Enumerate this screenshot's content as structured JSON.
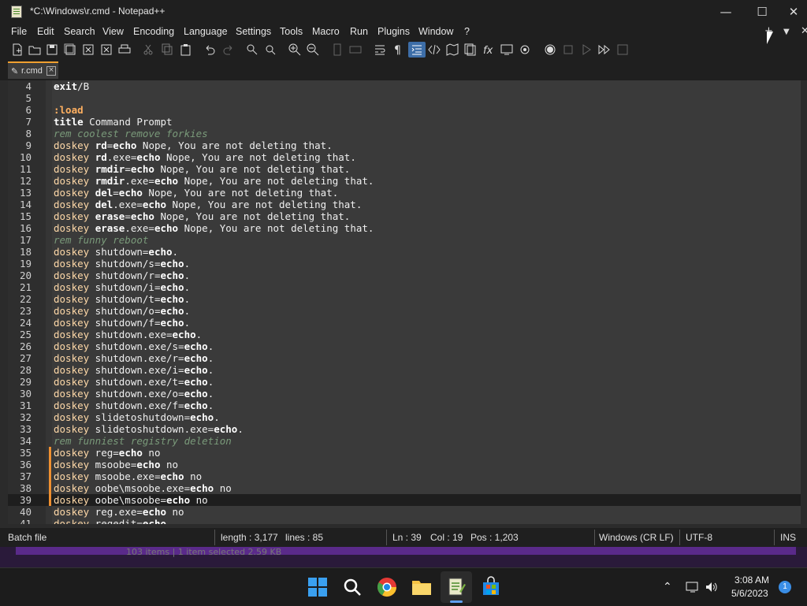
{
  "window": {
    "title": "*C:\\Windows\\r.cmd - Notepad++"
  },
  "menu": [
    "File",
    "Edit",
    "Search",
    "View",
    "Encoding",
    "Language",
    "Settings",
    "Tools",
    "Macro",
    "Run",
    "Plugins",
    "Window",
    "?"
  ],
  "menu_right": {
    "plus": "+",
    "dropdown": "▼",
    "close": "✕"
  },
  "tab": {
    "name": "r.cmd"
  },
  "lines": [
    {
      "n": "4",
      "parts": [
        [
          "cmd",
          "exit"
        ],
        [
          "",
          "/B"
        ]
      ]
    },
    {
      "n": "5",
      "parts": []
    },
    {
      "n": "6",
      "parts": [
        [
          "lbl",
          ":load"
        ]
      ]
    },
    {
      "n": "7",
      "parts": [
        [
          "cmd",
          "title"
        ],
        [
          "",
          " Command Prompt"
        ]
      ]
    },
    {
      "n": "8",
      "parts": [
        [
          "cmt",
          "rem coolest remove forkies"
        ]
      ]
    },
    {
      "n": "9",
      "parts": [
        [
          "kw",
          "doskey"
        ],
        [
          "",
          " "
        ],
        [
          "cmd",
          "rd"
        ],
        [
          "",
          "="
        ],
        [
          "cmd",
          "echo"
        ],
        [
          "",
          " Nope, You are not deleting that."
        ]
      ]
    },
    {
      "n": "10",
      "parts": [
        [
          "kw",
          "doskey"
        ],
        [
          "",
          " "
        ],
        [
          "cmd",
          "rd"
        ],
        [
          "",
          ".exe="
        ],
        [
          "cmd",
          "echo"
        ],
        [
          "",
          " Nope, You are not deleting that."
        ]
      ]
    },
    {
      "n": "11",
      "parts": [
        [
          "kw",
          "doskey"
        ],
        [
          "",
          " "
        ],
        [
          "cmd",
          "rmdir"
        ],
        [
          "",
          "="
        ],
        [
          "cmd",
          "echo"
        ],
        [
          "",
          " Nope, You are not deleting that."
        ]
      ]
    },
    {
      "n": "12",
      "parts": [
        [
          "kw",
          "doskey"
        ],
        [
          "",
          " "
        ],
        [
          "cmd",
          "rmdir"
        ],
        [
          "",
          ".exe="
        ],
        [
          "cmd",
          "echo"
        ],
        [
          "",
          " Nope, You are not deleting that."
        ]
      ]
    },
    {
      "n": "13",
      "parts": [
        [
          "kw",
          "doskey"
        ],
        [
          "",
          " "
        ],
        [
          "cmd",
          "del"
        ],
        [
          "",
          "="
        ],
        [
          "cmd",
          "echo"
        ],
        [
          "",
          " Nope, You are not deleting that."
        ]
      ]
    },
    {
      "n": "14",
      "parts": [
        [
          "kw",
          "doskey"
        ],
        [
          "",
          " "
        ],
        [
          "cmd",
          "del"
        ],
        [
          "",
          ".exe="
        ],
        [
          "cmd",
          "echo"
        ],
        [
          "",
          " Nope, You are not deleting that."
        ]
      ]
    },
    {
      "n": "15",
      "parts": [
        [
          "kw",
          "doskey"
        ],
        [
          "",
          " "
        ],
        [
          "cmd",
          "erase"
        ],
        [
          "",
          "="
        ],
        [
          "cmd",
          "echo"
        ],
        [
          "",
          " Nope, You are not deleting that."
        ]
      ]
    },
    {
      "n": "16",
      "parts": [
        [
          "kw",
          "doskey"
        ],
        [
          "",
          " "
        ],
        [
          "cmd",
          "erase"
        ],
        [
          "",
          ".exe="
        ],
        [
          "cmd",
          "echo"
        ],
        [
          "",
          " Nope, You are not deleting that."
        ]
      ]
    },
    {
      "n": "17",
      "parts": [
        [
          "cmt",
          "rem funny reboot"
        ]
      ]
    },
    {
      "n": "18",
      "parts": [
        [
          "kw",
          "doskey"
        ],
        [
          "",
          " shutdown="
        ],
        [
          "cmd",
          "echo"
        ],
        [
          "",
          "."
        ]
      ]
    },
    {
      "n": "19",
      "parts": [
        [
          "kw",
          "doskey"
        ],
        [
          "",
          " shutdown/s="
        ],
        [
          "cmd",
          "echo"
        ],
        [
          "",
          "."
        ]
      ]
    },
    {
      "n": "20",
      "parts": [
        [
          "kw",
          "doskey"
        ],
        [
          "",
          " shutdown/r="
        ],
        [
          "cmd",
          "echo"
        ],
        [
          "",
          "."
        ]
      ]
    },
    {
      "n": "21",
      "parts": [
        [
          "kw",
          "doskey"
        ],
        [
          "",
          " shutdown/i="
        ],
        [
          "cmd",
          "echo"
        ],
        [
          "",
          "."
        ]
      ]
    },
    {
      "n": "22",
      "parts": [
        [
          "kw",
          "doskey"
        ],
        [
          "",
          " shutdown/t="
        ],
        [
          "cmd",
          "echo"
        ],
        [
          "",
          "."
        ]
      ]
    },
    {
      "n": "23",
      "parts": [
        [
          "kw",
          "doskey"
        ],
        [
          "",
          " shutdown/o="
        ],
        [
          "cmd",
          "echo"
        ],
        [
          "",
          "."
        ]
      ]
    },
    {
      "n": "24",
      "parts": [
        [
          "kw",
          "doskey"
        ],
        [
          "",
          " shutdown/f="
        ],
        [
          "cmd",
          "echo"
        ],
        [
          "",
          "."
        ]
      ]
    },
    {
      "n": "25",
      "parts": [
        [
          "kw",
          "doskey"
        ],
        [
          "",
          " shutdown.exe="
        ],
        [
          "cmd",
          "echo"
        ],
        [
          "",
          "."
        ]
      ]
    },
    {
      "n": "26",
      "parts": [
        [
          "kw",
          "doskey"
        ],
        [
          "",
          " shutdown.exe/s="
        ],
        [
          "cmd",
          "echo"
        ],
        [
          "",
          "."
        ]
      ]
    },
    {
      "n": "27",
      "parts": [
        [
          "kw",
          "doskey"
        ],
        [
          "",
          " shutdown.exe/r="
        ],
        [
          "cmd",
          "echo"
        ],
        [
          "",
          "."
        ]
      ]
    },
    {
      "n": "28",
      "parts": [
        [
          "kw",
          "doskey"
        ],
        [
          "",
          " shutdown.exe/i="
        ],
        [
          "cmd",
          "echo"
        ],
        [
          "",
          "."
        ]
      ]
    },
    {
      "n": "29",
      "parts": [
        [
          "kw",
          "doskey"
        ],
        [
          "",
          " shutdown.exe/t="
        ],
        [
          "cmd",
          "echo"
        ],
        [
          "",
          "."
        ]
      ]
    },
    {
      "n": "30",
      "parts": [
        [
          "kw",
          "doskey"
        ],
        [
          "",
          " shutdown.exe/o="
        ],
        [
          "cmd",
          "echo"
        ],
        [
          "",
          "."
        ]
      ]
    },
    {
      "n": "31",
      "parts": [
        [
          "kw",
          "doskey"
        ],
        [
          "",
          " shutdown.exe/f="
        ],
        [
          "cmd",
          "echo"
        ],
        [
          "",
          "."
        ]
      ]
    },
    {
      "n": "32",
      "parts": [
        [
          "kw",
          "doskey"
        ],
        [
          "",
          " slidetoshutdown="
        ],
        [
          "cmd",
          "echo"
        ],
        [
          "",
          "."
        ]
      ]
    },
    {
      "n": "33",
      "parts": [
        [
          "kw",
          "doskey"
        ],
        [
          "",
          " slidetoshutdown.exe="
        ],
        [
          "cmd",
          "echo"
        ],
        [
          "",
          "."
        ]
      ]
    },
    {
      "n": "34",
      "parts": [
        [
          "cmt",
          "rem funniest registry deletion"
        ]
      ]
    },
    {
      "n": "35",
      "changed": true,
      "parts": [
        [
          "kw",
          "doskey"
        ],
        [
          "",
          " reg="
        ],
        [
          "cmd",
          "echo"
        ],
        [
          "",
          " no"
        ]
      ]
    },
    {
      "n": "36",
      "changed": true,
      "parts": [
        [
          "kw",
          "doskey"
        ],
        [
          "",
          " msoobe="
        ],
        [
          "cmd",
          "echo"
        ],
        [
          "",
          " no"
        ]
      ]
    },
    {
      "n": "37",
      "changed": true,
      "parts": [
        [
          "kw",
          "doskey"
        ],
        [
          "",
          " msoobe.exe="
        ],
        [
          "cmd",
          "echo"
        ],
        [
          "",
          " no"
        ]
      ]
    },
    {
      "n": "38",
      "changed": true,
      "parts": [
        [
          "kw",
          "doskey"
        ],
        [
          "",
          " oobe\\msoobe.exe="
        ],
        [
          "cmd",
          "echo"
        ],
        [
          "",
          " no"
        ]
      ]
    },
    {
      "n": "39",
      "changed": true,
      "current": true,
      "parts": [
        [
          "kw",
          "doskey"
        ],
        [
          "",
          " oobe\\msoobe="
        ],
        [
          "cmd",
          "echo"
        ],
        [
          "",
          " no"
        ]
      ]
    },
    {
      "n": "40",
      "parts": [
        [
          "kw",
          "doskey"
        ],
        [
          "",
          " reg.exe="
        ],
        [
          "cmd",
          "echo"
        ],
        [
          "",
          " no"
        ]
      ]
    },
    {
      "n": "41",
      "parts": [
        [
          "kw",
          "doskey"
        ],
        [
          "",
          " regedit="
        ],
        [
          "cmd",
          "echo"
        ]
      ]
    }
  ],
  "status": {
    "filetype": "Batch file",
    "length": "length : 3,177",
    "lines": "lines : 85",
    "ln": "Ln : 39",
    "col": "Col : 19",
    "pos": "Pos : 1,203",
    "eol": "Windows (CR LF)",
    "encoding": "UTF-8",
    "mode": "INS"
  },
  "behind": {
    "text": "103 items  |  1 item selected  2.59 KB"
  },
  "taskbar": {
    "time": "3:08 AM",
    "date": "5/6/2023",
    "notifications": "1"
  },
  "colors": {
    "accent_tab": "#f0a030",
    "change_mark": "#f09030"
  }
}
